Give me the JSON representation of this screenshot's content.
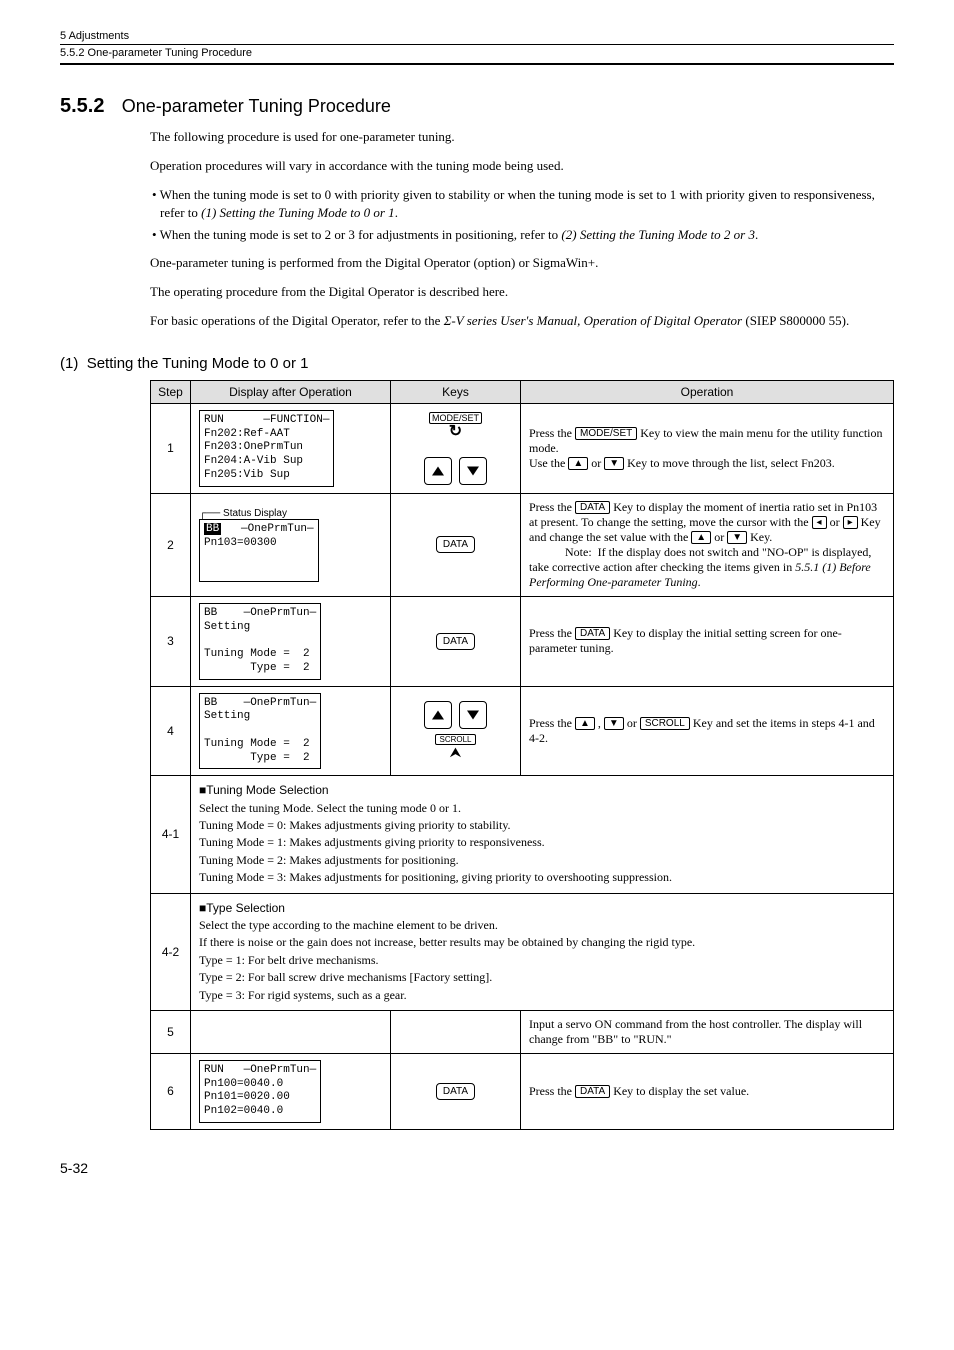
{
  "header": {
    "chapter": "5  Adjustments",
    "section": "5.5.2  One-parameter Tuning Procedure"
  },
  "title": {
    "num": "5.5.2",
    "text": "One-parameter Tuning Procedure"
  },
  "intro": {
    "p1": "The following procedure is used for one-parameter tuning.",
    "p2": "Operation procedures will vary in accordance with the tuning mode being used.",
    "b1a": "• When the tuning mode is set to 0 with priority given to stability or when the tuning mode is set to 1 with priority given to responsiveness, refer to ",
    "b1b": "(1) Setting the Tuning Mode to 0 or 1",
    "b1c": ".",
    "b2a": "• When the tuning mode is set to 2 or 3 for adjustments in positioning, refer to ",
    "b2b": "(2) Setting the Tuning Mode to 2 or 3",
    "b2c": ".",
    "p3": "One-parameter tuning is performed from the Digital Operator (option) or SigmaWin+.",
    "p4": "The operating procedure from the Digital Operator is described here.",
    "p5a": "For basic operations of the Digital Operator, refer to the ",
    "p5b": "Σ-V series User's Manual, Operation of Digital Operator",
    "p5c": " (SIEP S800000 55)."
  },
  "sub1": {
    "num": "(1)",
    "title": "Setting the Tuning Mode to 0 or 1"
  },
  "th": {
    "step": "Step",
    "disp": "Display after Operation",
    "keys": "Keys",
    "op": "Operation"
  },
  "keys": {
    "modeset": "MODE/SET",
    "data": "DATA",
    "scroll": "SCROLL"
  },
  "inline": {
    "up": "▲",
    "down": "▼",
    "left": "◂",
    "right": "▸",
    "data": "DATA",
    "modeset": "MODE/SET",
    "scroll": "SCROLL"
  },
  "lcd": {
    "s1": "RUN      —FUNCTION—\nFn202:Ref-AAT\nFn203:OnePrmTun\nFn204:A-Vib Sup\nFn205:Vib Sup",
    "s2_status": "Status Display",
    "s2_hdr": "   —OnePrmTun—",
    "s2_body": "Pn103=00300",
    "s2_bb": "BB",
    "s3": "BB    —OnePrmTun—\nSetting\n\nTuning Mode =  2\n       Type =  2",
    "s4": "BB    —OnePrmTun—\nSetting\n\nTuning Mode =  2\n       Type =  2",
    "s6": "RUN   —OnePrmTun—\nPn100=0040.0\nPn101=0020.00\nPn102=0040.0"
  },
  "op": {
    "s1": {
      "a": "Press the ",
      "b": " Key to view the main menu for the utility function mode.",
      "c": "Use the ",
      "d": " or ",
      "e": " Key to move through the list, select Fn203."
    },
    "s2": {
      "a": "Press the ",
      "b": " Key to display the moment of inertia ratio set in Pn103 at present. To change the setting, move the cursor with the ",
      "c": " or ",
      "d": " Key and change the set value with the ",
      "e": " or ",
      "f": " Key.",
      "note_lbl": "Note:",
      "note": "If the display does not switch and \"NO-OP\" is displayed, take corrective action after checking the items given in ",
      "note_ref": "5.5.1 (1) Before Performing One-parameter Tuning",
      "note_end": "."
    },
    "s3": {
      "a": "Press the ",
      "b": " Key to display the initial setting screen for one-parameter tuning."
    },
    "s4": {
      "a": "Press the ",
      "b": " , ",
      "c": " or ",
      "d": " Key and set the items in steps 4-1 and 4-2."
    },
    "s5": "Input a servo ON command from the host controller. The display will change from \"BB\" to \"RUN.\"",
    "s6": {
      "a": "Press the ",
      "b": " Key to display the set value."
    }
  },
  "row41": {
    "h": "■Tuning Mode Selection",
    "l1": "Select the tuning Mode. Select the tuning mode 0 or 1.",
    "l2": "Tuning Mode = 0: Makes adjustments giving priority to stability.",
    "l3": "Tuning Mode = 1: Makes adjustments giving priority to responsiveness.",
    "l4": "Tuning Mode = 2: Makes adjustments for positioning.",
    "l5": "Tuning Mode = 3: Makes adjustments for positioning, giving priority to overshooting suppression."
  },
  "row42": {
    "h": "■Type Selection",
    "l1": "Select the type according to the machine element to be driven.",
    "l2": "If there is noise or the gain does not increase, better results may be obtained by changing the rigid type.",
    "l3": "Type = 1: For belt drive mechanisms.",
    "l4": "Type = 2: For ball screw drive mechanisms [Factory setting].",
    "l5": "Type = 3: For rigid systems, such as a gear."
  },
  "steps": {
    "s1": "1",
    "s2": "2",
    "s3": "3",
    "s4": "4",
    "s41": "4-1",
    "s42": "4-2",
    "s5": "5",
    "s6": "6"
  },
  "footer": {
    "page": "5-32"
  }
}
